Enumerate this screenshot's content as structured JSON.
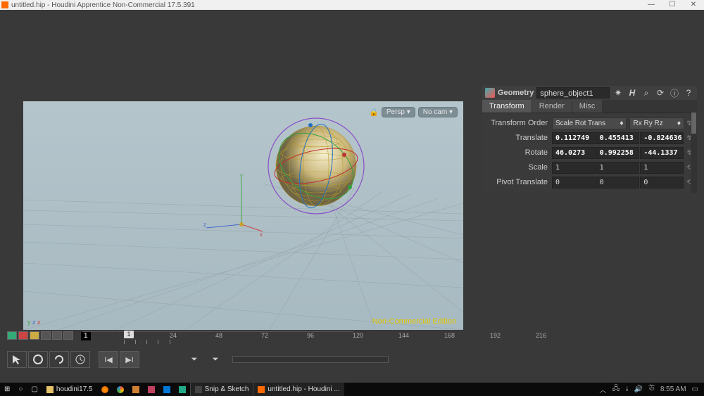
{
  "window": {
    "title": "untitled.hip - Houdini Apprentice Non-Commercial 17.5.391",
    "controls": {
      "min": "—",
      "max": "☐",
      "close": "✕"
    }
  },
  "viewport": {
    "persp_label": "Persp ▾",
    "cam_label": "No cam ▾",
    "watermark": "Non-Commercial Edition",
    "axis_labels": {
      "x": "x",
      "y": "y",
      "z": "z"
    },
    "mini_axis": {
      "x": "x",
      "y": "y",
      "z": "z"
    }
  },
  "timeline": {
    "ticks": [
      24,
      48,
      72,
      96,
      120,
      144,
      168,
      192,
      216
    ],
    "current_frame": 1,
    "start_frame": 1
  },
  "param": {
    "type": "Geometry",
    "name": "sphere_object1",
    "tabs": [
      "Transform",
      "Render",
      "Misc"
    ],
    "active_tab": 0,
    "rows": {
      "xord_label": "Transform Order",
      "xord_value": "Scale Rot Trans",
      "rord_value": "Rx Ry Rz",
      "translate_label": "Translate",
      "translate": [
        "0.112749",
        "0.455413",
        "-0.824636"
      ],
      "rotate_label": "Rotate",
      "rotate": [
        "46.0273",
        "0.992258",
        "-44.1337"
      ],
      "scale_label": "Scale",
      "scale": [
        "1",
        "1",
        "1"
      ],
      "pivot_label": "Pivot Translate",
      "pivot": [
        "0",
        "0",
        "0"
      ]
    },
    "header_icons": {
      "gear": "✷",
      "h": "H",
      "search": "⌕",
      "reload": "⟳",
      "info": "ⓘ",
      "help": "?"
    }
  },
  "taskbar": {
    "start": "⊞",
    "search": "○",
    "cortana": "▢",
    "folder": "houdini17.5",
    "apps": [
      {
        "icon": "snip-icon",
        "label": "Snip & Sketch"
      },
      {
        "icon": "hou-icon",
        "label": "untitled.hip - Houdini ..."
      }
    ],
    "tray": {
      "up": "︿",
      "net": "🖧",
      "wifi": "⫰",
      "vol": "🔊",
      "lang": "ঊ",
      "time": "8:55 AM",
      "notif": "▭"
    }
  }
}
